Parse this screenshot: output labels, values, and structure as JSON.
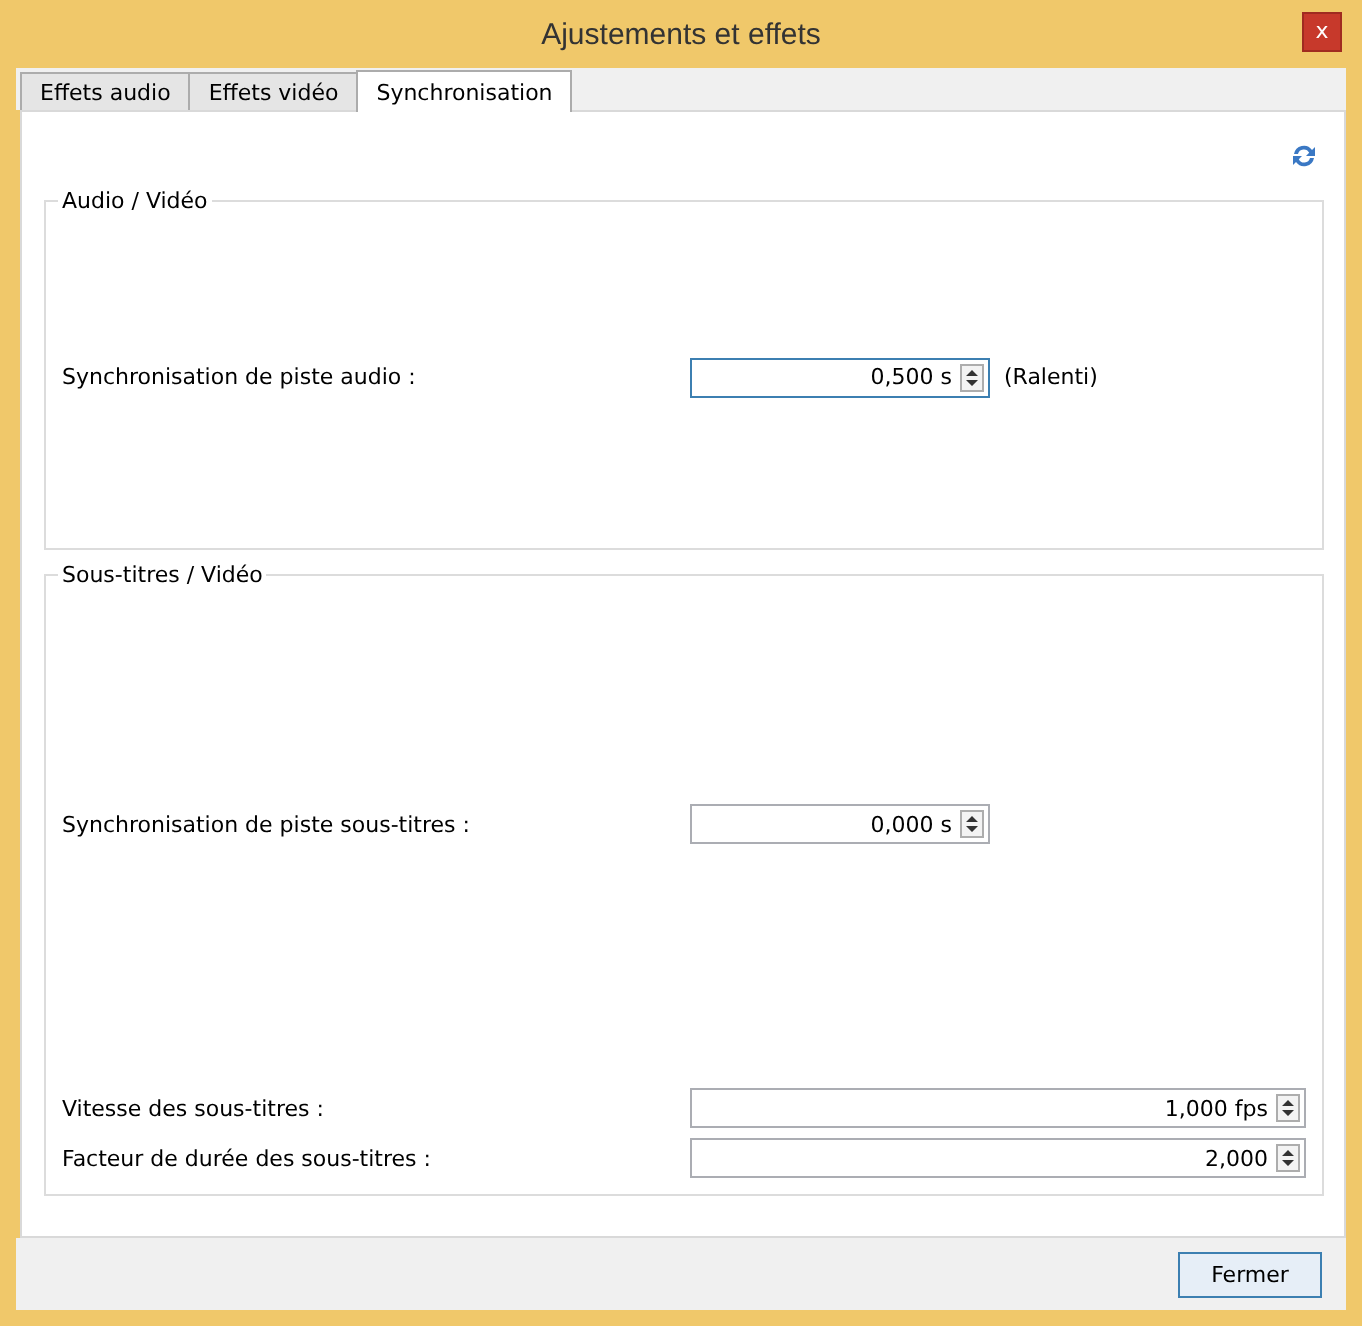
{
  "window": {
    "title": "Ajustements et effets",
    "close": "x"
  },
  "tabs": [
    {
      "label": "Effets audio",
      "selected": false
    },
    {
      "label": "Effets vidéo",
      "selected": false
    },
    {
      "label": "Synchronisation",
      "selected": true
    }
  ],
  "groups": [
    {
      "title": "Audio / Vidéo",
      "rows": [
        {
          "kind": "short",
          "label": "Synchronisation de piste audio :",
          "value": "0,500 s",
          "focused": true,
          "note": "(Ralenti)"
        }
      ]
    },
    {
      "title": "Sous-titres / Vidéo",
      "rows": [
        {
          "kind": "short",
          "label": "Synchronisation de piste sous-titres :",
          "value": "0,000 s",
          "focused": false
        },
        {
          "kind": "wide",
          "label": "Vitesse des sous-titres :",
          "value": "1,000 fps",
          "focused": false
        },
        {
          "kind": "wide",
          "label": "Facteur de durée des sous-titres :",
          "value": "2,000",
          "focused": false
        }
      ]
    }
  ],
  "buttons": [
    "Fermer"
  ]
}
